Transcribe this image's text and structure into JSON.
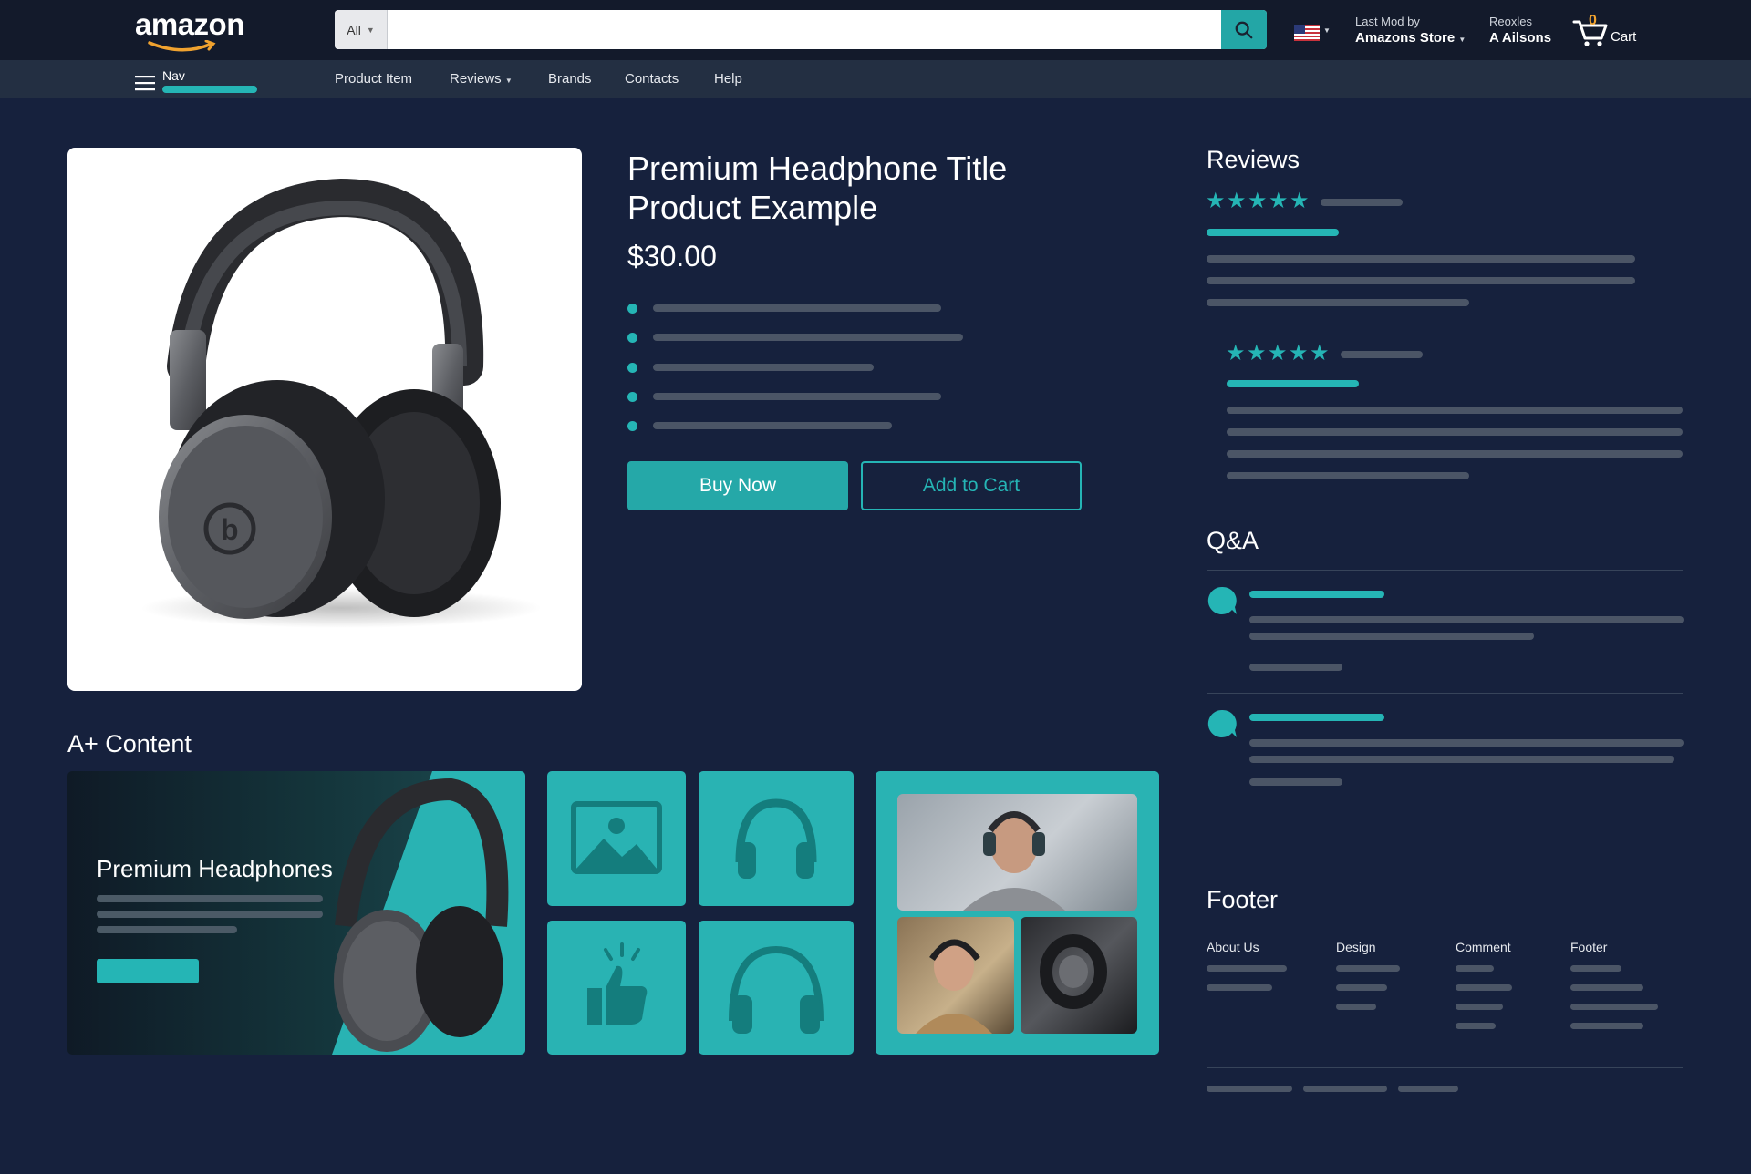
{
  "header": {
    "logo": "amazon",
    "search_category": "All",
    "search_placeholder": "",
    "last_mod_line1": "Last Mod by",
    "last_mod_line2": "Amazons Store",
    "account_line1": "Reoxles",
    "account_line2": "A Ailsons",
    "cart_count": "0",
    "cart_label": "Cart"
  },
  "subnav": {
    "menu_label": "Nav",
    "items": [
      "Product Item",
      "Reviews",
      "Brands",
      "Contacts",
      "Help"
    ]
  },
  "product": {
    "title_line1": "Premium Headphone Title",
    "title_line2": "Product Example",
    "price": "$30.00",
    "buy_now": "Buy Now",
    "add_to_cart": "Add to Cart"
  },
  "reviews": {
    "heading": "Reviews",
    "rating_stars": 5
  },
  "qa": {
    "heading": "Q&A"
  },
  "aplus": {
    "heading": "A+ Content",
    "banner_title": "Premium Headphones"
  },
  "footer": {
    "heading": "Footer",
    "columns": [
      "About Us",
      "Design",
      "Comment",
      "Footer"
    ]
  },
  "colors": {
    "background": "#16213d",
    "topbar": "#131a2b",
    "subnav": "#232f42",
    "accent": "#25b5b5",
    "skeleton": "#4b5566"
  },
  "icons": [
    "menu-icon",
    "search-icon",
    "flag-us-icon",
    "chevron-down-icon",
    "cart-icon",
    "star-icon",
    "chat-bubble-icon",
    "image-icon",
    "headphones-icon",
    "thumbs-up-icon"
  ]
}
